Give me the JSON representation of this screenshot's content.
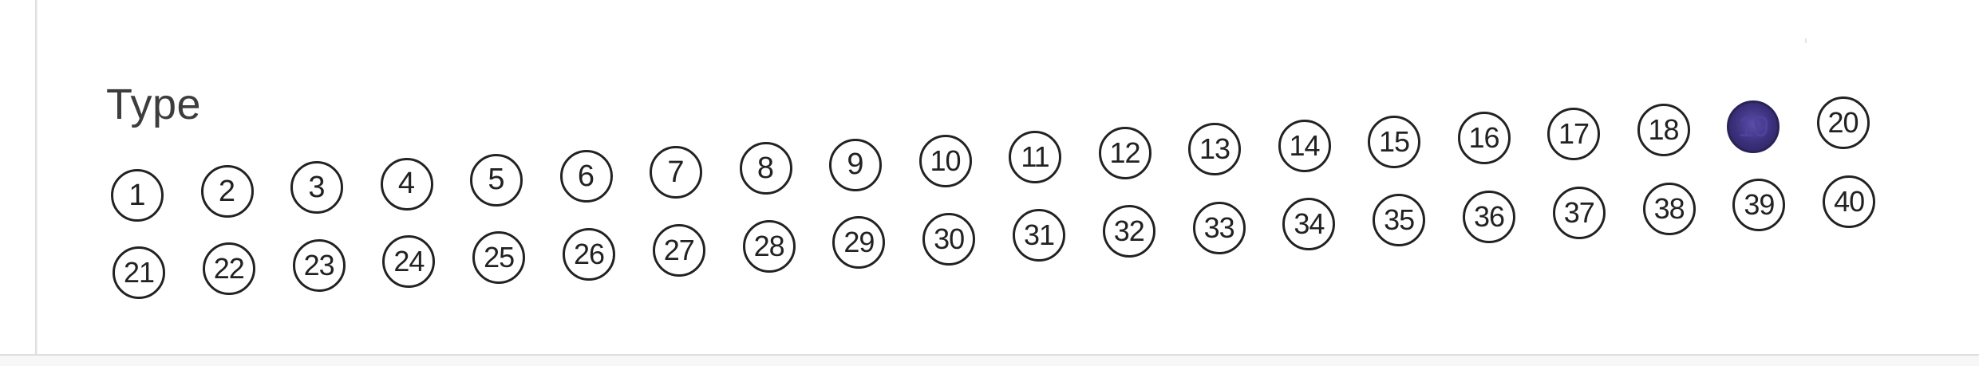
{
  "form": {
    "title": "Type",
    "selected": "19",
    "filled_color": "#3a2f7a",
    "row1": [
      "1",
      "2",
      "3",
      "4",
      "5",
      "6",
      "7",
      "8",
      "9",
      "10",
      "11",
      "12",
      "13",
      "14",
      "15",
      "16",
      "17",
      "18",
      "19",
      "20"
    ],
    "row2": [
      "21",
      "22",
      "23",
      "24",
      "25",
      "26",
      "27",
      "28",
      "29",
      "30",
      "31",
      "32",
      "33",
      "34",
      "35",
      "36",
      "37",
      "38",
      "39",
      "40"
    ]
  }
}
